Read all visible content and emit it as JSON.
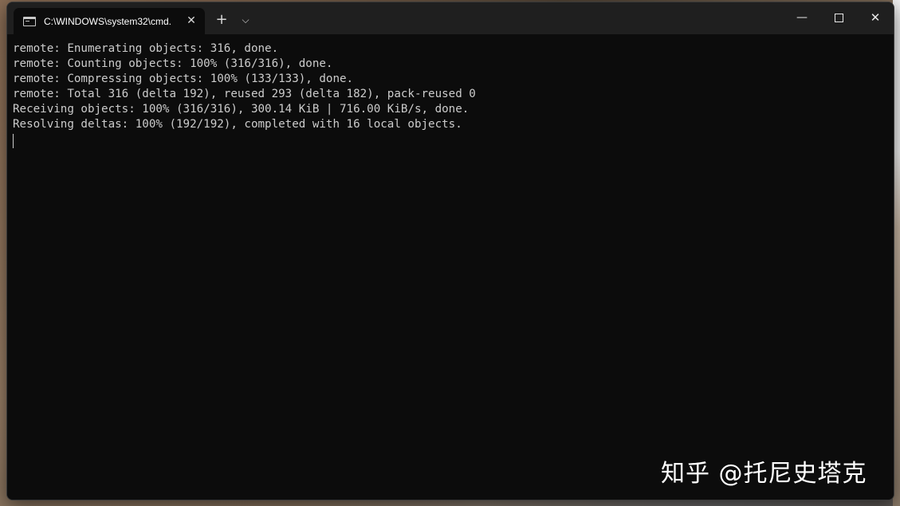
{
  "window": {
    "tab_title": "C:\\WINDOWS\\system32\\cmd.",
    "tab_close": "✕",
    "new_tab": "+",
    "dropdown": "⌵",
    "minimize": "—",
    "close": "✕"
  },
  "terminal": {
    "lines": [
      "remote: Enumerating objects: 316, done.",
      "remote: Counting objects: 100% (316/316), done.",
      "remote: Compressing objects: 100% (133/133), done.",
      "remote: Total 316 (delta 192), reused 293 (delta 182), pack-reused 0",
      "Receiving objects: 100% (316/316), 300.14 KiB | 716.00 KiB/s, done.",
      "Resolving deltas: 100% (192/192), completed with 16 local objects."
    ]
  },
  "watermark": "知乎 @托尼史塔克",
  "icons": {
    "tab_icon": "cmd-terminal-icon"
  }
}
